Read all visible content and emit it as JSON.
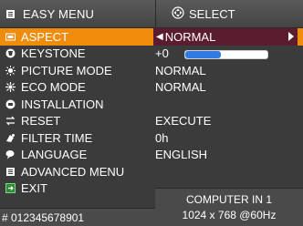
{
  "header": {
    "title": "EASY MENU",
    "title_icon": "menu-list-icon",
    "select_label": "SELECT",
    "select_icon": "dpad-icon"
  },
  "menu": [
    {
      "label": "ASPECT",
      "icon": "aspect-icon",
      "value": "NORMAL",
      "selected": true
    },
    {
      "label": "KEYSTONE",
      "icon": "keystone-icon",
      "value": "+0",
      "slider_fraction": 0.43
    },
    {
      "label": "PICTURE MODE",
      "icon": "picture-mode-icon",
      "value": "NORMAL"
    },
    {
      "label": "ECO MODE",
      "icon": "eco-mode-icon",
      "value": "NORMAL"
    },
    {
      "label": "INSTALLATION",
      "icon": "installation-icon",
      "value": ""
    },
    {
      "label": "RESET",
      "icon": "reset-icon",
      "value": "EXECUTE"
    },
    {
      "label": "FILTER TIME",
      "icon": "filter-time-icon",
      "value": "0h"
    },
    {
      "label": "LANGUAGE",
      "icon": "language-icon",
      "value": "ENGLISH"
    },
    {
      "label": "ADVANCED MENU",
      "icon": "advanced-menu-icon",
      "value": ""
    },
    {
      "label": "EXIT",
      "icon": "exit-icon",
      "value": ""
    }
  ],
  "info": {
    "input": "COMPUTER IN 1",
    "resolution": "1024 x 768 @60Hz"
  },
  "footer": {
    "serial": "# 012345678901"
  },
  "colors": {
    "highlight": "#ef8c0c",
    "value_box": "#5b1d2e",
    "slider_fill": "#2f7be2"
  }
}
